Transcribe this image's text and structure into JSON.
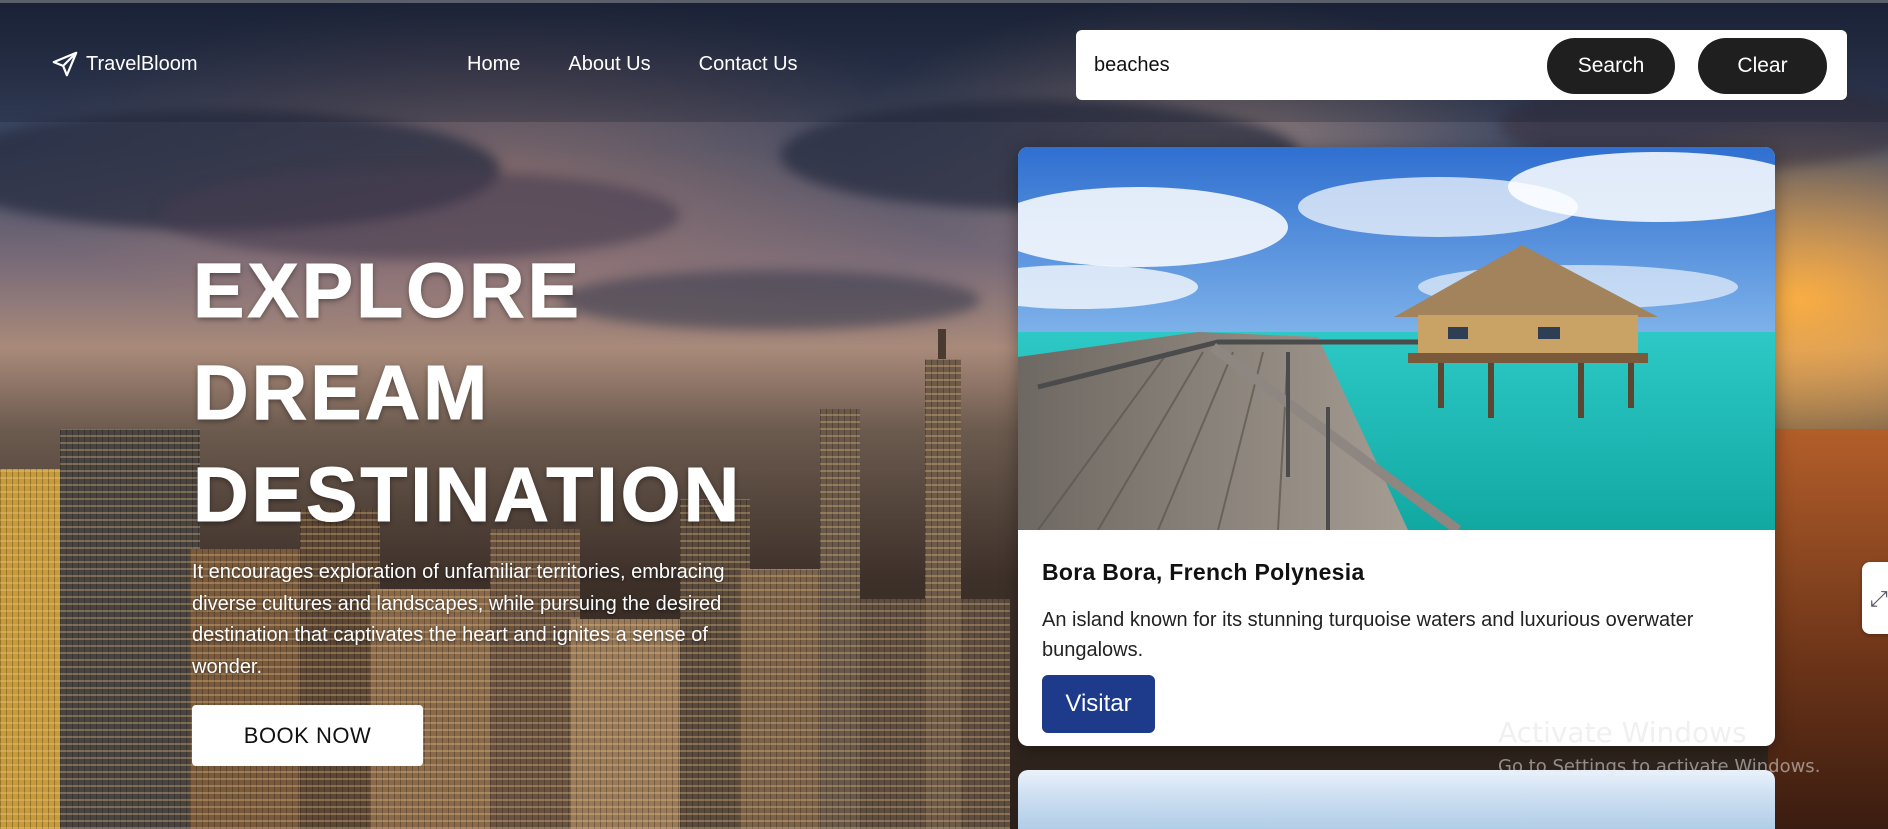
{
  "brand": {
    "name": "TravelBloom",
    "icon": "paper-plane-icon"
  },
  "nav": {
    "links": [
      "Home",
      "About Us",
      "Contact Us"
    ]
  },
  "search": {
    "value": "beaches",
    "search_label": "Search",
    "clear_label": "Clear"
  },
  "hero": {
    "title_lines": [
      "EXPLORE",
      "DREAM",
      "DESTINATION"
    ],
    "description": "It encourages exploration of unfamiliar territories, embracing diverse cultures and landscapes, while pursuing the desired destination that captivates the heart and ignites a sense of wonder.",
    "cta_label": "BOOK NOW"
  },
  "results": [
    {
      "title": "Bora Bora, French Polynesia",
      "description": "An island known for its stunning turquoise waters and luxurious overwater bungalows.",
      "button_label": "Visitar"
    }
  ],
  "watermark": {
    "title": "Activate Windows",
    "subtitle": "Go to Settings to activate Windows."
  },
  "colors": {
    "visit_button": "#1e3a8a",
    "dark_button": "#1f1f1f"
  }
}
